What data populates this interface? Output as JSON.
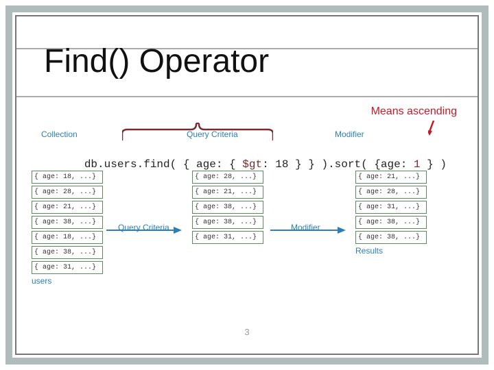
{
  "title": "Find() Operator",
  "annotation": "Means ascending",
  "page_number": "3",
  "labels": {
    "collection": "Collection",
    "query_criteria": "Query Criteria",
    "modifier": "Modifier",
    "users_caption": "users",
    "results_caption": "Results"
  },
  "code": {
    "p1": "db.users.find( { age: { ",
    "p2": "$gt",
    "p3": ": 18 } } ).sort( {age: ",
    "p4": "1",
    "p5": " } )"
  },
  "columns": {
    "source": [
      "{ age: 18, ...}",
      "{ age: 28, ...}",
      "{ age: 21, ...}",
      "{ age: 38, ...}",
      "{ age: 18, ...}",
      "{ age: 38, ...}",
      "{ age: 31, ...}"
    ],
    "filtered": [
      "{ age: 28, ...}",
      "{ age: 21, ...}",
      "{ age: 38, ...}",
      "{ age: 38, ...}",
      "{ age: 31, ...}"
    ],
    "sorted": [
      "{ age: 21, ...}",
      "{ age: 28, ...}",
      "{ age: 31, ...}",
      "{ age: 38, ...}",
      "{ age: 38, ...}"
    ]
  }
}
